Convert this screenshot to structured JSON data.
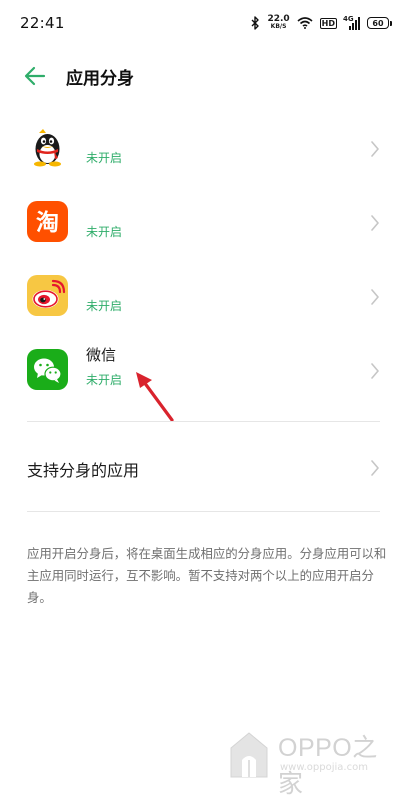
{
  "status_bar": {
    "time": "22:41",
    "net_speed_value": "22.0",
    "net_speed_unit": "KB/S",
    "hd_label": "HD",
    "signal_label": "4G",
    "battery": "60"
  },
  "header": {
    "title": "应用分身"
  },
  "apps": [
    {
      "name": "",
      "status": "未开启",
      "icon": "qq-penguin-icon"
    },
    {
      "name": "",
      "status": "未开启",
      "icon": "taobao-icon"
    },
    {
      "name": "",
      "status": "未开启",
      "icon": "weibo-icon"
    },
    {
      "name": "微信",
      "status": "未开启",
      "icon": "wechat-icon"
    }
  ],
  "support": {
    "label": "支持分身的应用"
  },
  "note": "应用开启分身后，将在桌面生成相应的分身应用。分身应用可以和主应用同时运行，互不影响。暂不支持对两个以上的应用开启分身。",
  "watermark": {
    "text": "OPPO之家",
    "url": "www.oppojia.com"
  },
  "colors": {
    "accent": "#2fad6a",
    "taobao": "#ff5000",
    "weibo": "#f7c743",
    "wechat": "#1aad19",
    "annotation_arrow": "#d9232d"
  }
}
